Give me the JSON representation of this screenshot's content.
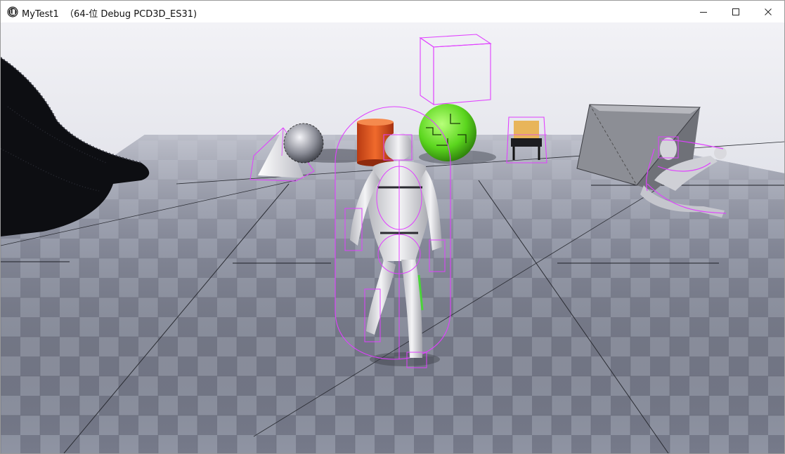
{
  "window": {
    "title": "MyTest1  （64-位 Debug PCD3D_ES31)",
    "app_icon": "unreal-engine-logo",
    "controls": {
      "minimize": "minimize-icon",
      "maximize": "maximize-icon",
      "close": "close-icon"
    }
  },
  "scene": {
    "sky_color": "#e9e9ef",
    "floor_light": "#8e93a2",
    "floor_dark": "#6f7383",
    "debug_color": "#e040ff",
    "objects": [
      "terrain-mesh",
      "cone",
      "sphere-metal",
      "cylinder-orange",
      "sphere-green",
      "floating-box",
      "chair",
      "large-cube",
      "player-mannequin",
      "ragdoll-mannequin"
    ]
  }
}
